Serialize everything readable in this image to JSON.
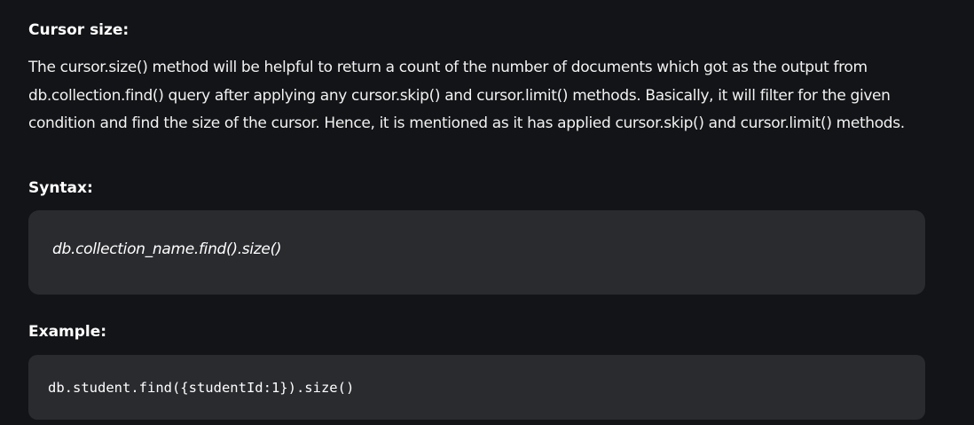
{
  "section": {
    "title": "Cursor size:",
    "description": "The cursor.size() method will be helpful to return a count of the number of documents which got as the output from db.collection.find() query after applying any cursor.skip() and cursor.limit() methods. Basically, it will filter for the given condition and find the size of the cursor. Hence, it is mentioned as it has applied cursor.skip() and cursor.limit() methods."
  },
  "syntax": {
    "label": "Syntax:",
    "code": "db.collection_name.find().size()"
  },
  "example": {
    "label": "Example:",
    "code": "db.student.find({studentId:1}).size()"
  },
  "colors": {
    "background": "#131417",
    "code_block": "#2a2b2f",
    "text": "#ffffff"
  }
}
